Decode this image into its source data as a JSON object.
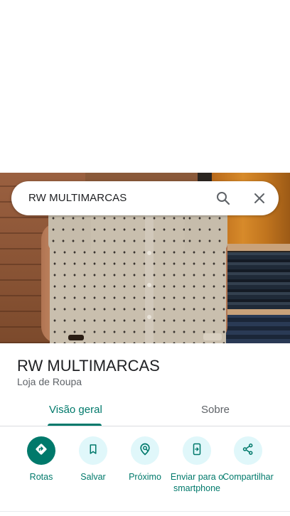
{
  "search": {
    "query": "RW MULTIMARCAS"
  },
  "place": {
    "name": "RW MULTIMARCAS",
    "category": "Loja de Roupa"
  },
  "tabs": [
    {
      "label": "Visão geral",
      "selected": true
    },
    {
      "label": "Sobre",
      "selected": false
    }
  ],
  "actions": [
    {
      "label": "Rotas",
      "icon": "directions-icon"
    },
    {
      "label": "Salvar",
      "icon": "bookmark-icon"
    },
    {
      "label": "Próximo",
      "icon": "nearby-icon"
    },
    {
      "label": "Enviar para o smartphone",
      "icon": "send-to-phone-icon"
    },
    {
      "label": "Compartilhar",
      "icon": "share-icon"
    }
  ],
  "colors": {
    "accent": "#00796b",
    "accent_light_bg": "#e0f7fa",
    "text_primary": "#202124",
    "text_secondary": "#5f6368"
  }
}
